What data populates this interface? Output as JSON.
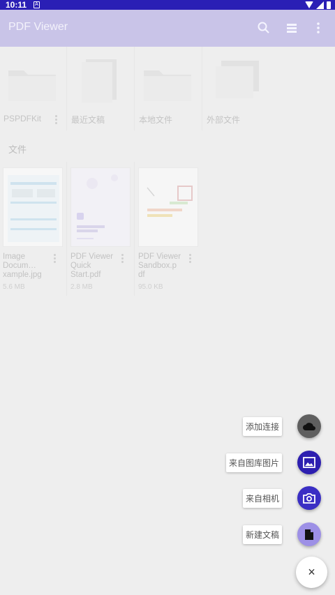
{
  "status_bar": {
    "time": "10:11",
    "notif": "A"
  },
  "app_bar": {
    "title": "PDF Viewer"
  },
  "folders": [
    {
      "label": "PSPDFKit",
      "has_menu": true
    },
    {
      "label": "最近文稿",
      "has_menu": false
    },
    {
      "label": "本地文件",
      "has_menu": false
    },
    {
      "label": "外部文件",
      "has_menu": false
    }
  ],
  "section": {
    "label": "文件"
  },
  "files": [
    {
      "name": "Image Docum... xample.jpg",
      "name_lines": [
        "Image",
        "Docum…",
        "xample.jpg"
      ],
      "size": "5.6 MB"
    },
    {
      "name": "PDF Viewer Quick Start.pdf",
      "name_lines": [
        "PDF Viewer",
        "Quick",
        "Start.pdf"
      ],
      "size": "2.8 MB"
    },
    {
      "name": "PDF Viewer Sandbox.pdf",
      "name_lines": [
        "PDF Viewer",
        "Sandbox.p",
        "df"
      ],
      "size": "95.0 KB"
    }
  ],
  "fab_menu": {
    "add_connection": "添加连接",
    "from_gallery": "来自图库图片",
    "from_camera": "来自相机",
    "new_document": "新建文稿",
    "close_symbol": "×"
  },
  "colors": {
    "status_bar": "#2a1fb5",
    "app_bar": "#c9c4e8",
    "cloud_fab": "#5f5f5f",
    "gallery_fab": "#2d1fb0",
    "camera_fab": "#3a2ec4",
    "new_doc_fab": "#9d90e6"
  },
  "icons": [
    "search-icon",
    "list-view-icon",
    "overflow-menu-icon",
    "cloud-icon",
    "image-icon",
    "camera-icon",
    "document-icon",
    "close-icon"
  ]
}
